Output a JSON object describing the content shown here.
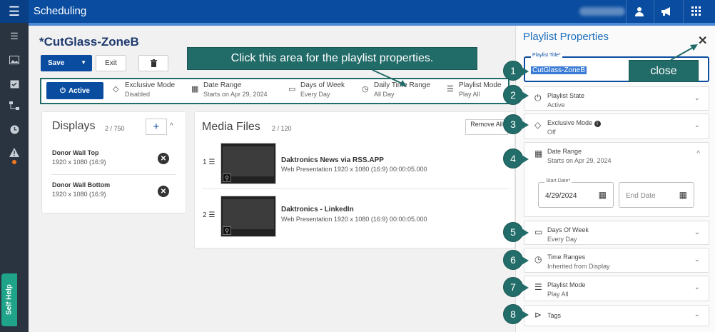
{
  "app": {
    "title": "Scheduling"
  },
  "page": {
    "title": "*CutGlass-ZoneB",
    "save_label": "Save",
    "exit_label": "Exit"
  },
  "propbar": {
    "state": "Active",
    "exclusive_label": "Exclusive Mode",
    "exclusive_value": "Disabled",
    "date_label": "Date Range",
    "date_value": "Starts on Apr 29, 2024",
    "days_label": "Days of Week",
    "days_value": "Every Day",
    "time_label": "Daily Time Range",
    "time_value": "All Day",
    "mode_label": "Playlist Mode",
    "mode_value": "Play All"
  },
  "displays": {
    "title": "Displays",
    "count": "2 / 750",
    "items": [
      {
        "name": "Donor Wall Top",
        "res": "1920 x 1080 (16:9)"
      },
      {
        "name": "Donor Wall Bottom",
        "res": "1920 x 1080 (16:9)"
      }
    ]
  },
  "media": {
    "title": "Media Files",
    "count": "2 / 120",
    "remove_label": "Remove All",
    "items": [
      {
        "num": "1",
        "title": "Daktronics News via RSS.APP",
        "sub": "Web Presentation  1920 x 1080 (16:9)  00:00:05.000"
      },
      {
        "num": "2",
        "title": "Daktronics - LinkedIn",
        "sub": "Web Presentation  1920 x 1080 (16:9)  00:00:05.000"
      }
    ]
  },
  "panel": {
    "title": "Playlist Properties",
    "title_field_label": "Playlist Title*",
    "title_field_value": "CutGlass-ZoneB",
    "state_label": "Playlist State",
    "state_value": "Active",
    "exclusive_label": "Exclusive Mode",
    "exclusive_value": "Off",
    "date_label": "Date Range",
    "date_value": "Starts on Apr 29, 2024",
    "start_label": "Start Date*",
    "start_value": "4/29/2024",
    "end_placeholder": "End Date",
    "days_label": "Days Of Week",
    "days_value": "Every Day",
    "time_label": "Time Ranges",
    "time_value": "Inherited from Display",
    "mode_label": "Playlist Mode",
    "mode_value": "Play All",
    "tags_label": "Tags"
  },
  "annotations": {
    "callout_main": "Click this area for the playlist properties.",
    "callout_close": "close",
    "numbers": [
      "1",
      "2",
      "3",
      "4",
      "5",
      "6",
      "7",
      "8"
    ]
  },
  "selfhelp": "Self Help",
  "colors": {
    "brand": "#0a4da0",
    "teal": "#226d6a",
    "nav": "#2a3440"
  }
}
